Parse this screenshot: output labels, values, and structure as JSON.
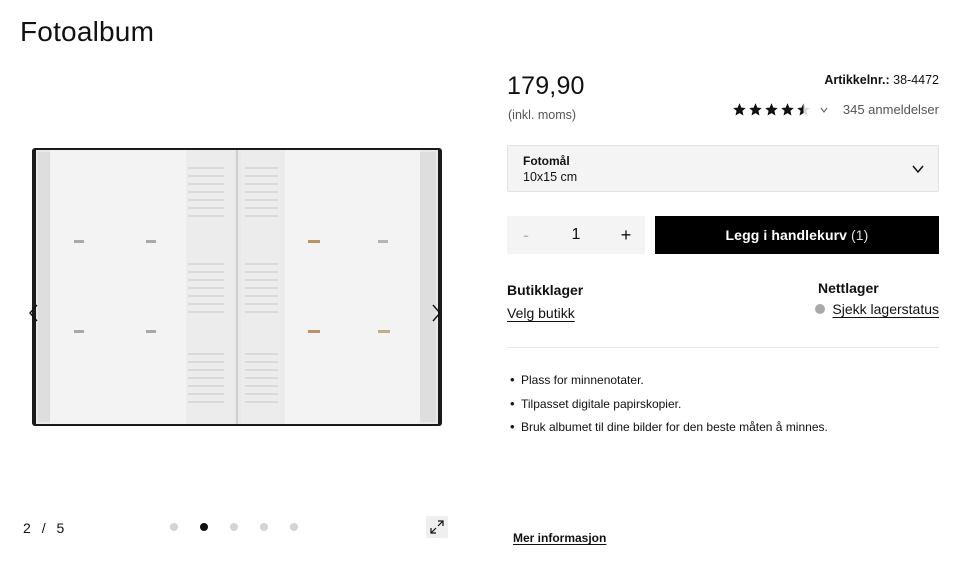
{
  "product": {
    "title": "Fotoalbum",
    "price": "179,90",
    "vat_note": "(inkl. moms)",
    "article_label": "Artikkelnr.:",
    "article_number": "38-4472",
    "rating": {
      "value": 4.5,
      "max": 5,
      "review_count_label": "345 anmeldelser"
    }
  },
  "gallery": {
    "current": "2",
    "separator": "/",
    "total": "5",
    "active_index": 1,
    "dot_count": 5,
    "icons": {
      "prev": "chevron-left-icon",
      "next": "chevron-right-icon",
      "expand": "expand-icon"
    }
  },
  "options": {
    "size_label": "Fotomål",
    "size_value": "10x15 cm"
  },
  "purchase": {
    "quantity": "1",
    "minus": "-",
    "plus": "+",
    "cart_label": "Legg i handlekurv",
    "cart_count": "(1)"
  },
  "stock": {
    "store_heading": "Butikklager",
    "store_link": "Velg butikk",
    "online_heading": "Nettlager",
    "online_link": "Sjekk lagerstatus",
    "status_color": "#a9a9a9"
  },
  "features": [
    "Plass for minnenotater.",
    "Tilpasset digitale papirskopier.",
    "Bruk albumet til dine bilder for den beste måten å minnes."
  ],
  "more_info": "Mer informasjon",
  "colors": {
    "button": "#000000",
    "panel": "#f4f4f4",
    "star": "#111111"
  }
}
